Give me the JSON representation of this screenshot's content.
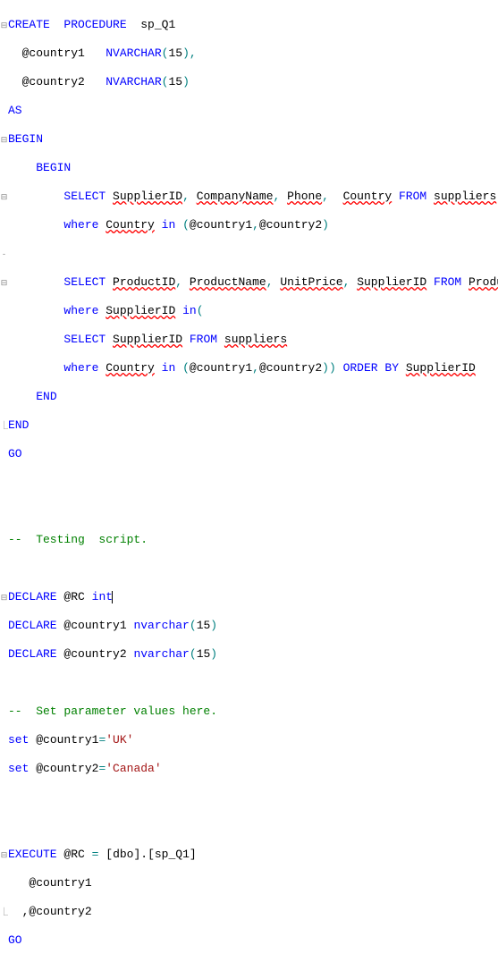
{
  "code": {
    "l1_kw1": "CREATE",
    "l1_kw2": "PROCEDURE",
    "l1_id": "sp_Q1",
    "l2_id": "@country1",
    "l2_type": "NVARCHAR",
    "l2_num": "15",
    "l3_id": "@country2",
    "l3_type": "NVARCHAR",
    "l3_num": "15",
    "l4": "AS",
    "l5": "BEGIN",
    "l6": "BEGIN",
    "l7_kw": "SELECT",
    "l7_c1": "SupplierID",
    "l7_c2": "CompanyName",
    "l7_c3": "Phone",
    "l7_c4": "Country",
    "l7_from": "FROM",
    "l7_tbl": "suppliers",
    "l8_where": "where",
    "l8_col": "Country",
    "l8_in": "in",
    "l8_p1": "@country1",
    "l8_p2": "@country2",
    "l10_kw": "SELECT",
    "l10_c1": "ProductID",
    "l10_c2": "ProductName",
    "l10_c3": "UnitPrice",
    "l10_c4": "SupplierID",
    "l10_from": "FROM",
    "l10_tbl": "Products",
    "l11_where": "where",
    "l11_col": "SupplierID",
    "l11_in": "in",
    "l12_kw": "SELECT",
    "l12_col": "SupplierID",
    "l12_from": "FROM",
    "l12_tbl": "suppliers",
    "l13_where": "where",
    "l13_col": "Country",
    "l13_in": "in",
    "l13_p1": "@country1",
    "l13_p2": "@country2",
    "l13_ord": "ORDER",
    "l13_by": "BY",
    "l13_oc": "SupplierID",
    "l14": "END",
    "l15": "END",
    "l16": "GO",
    "l19": "--  Testing  script.",
    "l21_kw": "DECLARE",
    "l21_id": "@RC",
    "l21_type": "int",
    "l22_kw": "DECLARE",
    "l22_id": "@country1",
    "l22_type": "nvarchar",
    "l22_num": "15",
    "l23_kw": "DECLARE",
    "l23_id": "@country2",
    "l23_type": "nvarchar",
    "l23_num": "15",
    "l25": "--  Set parameter values here.",
    "l26_kw": "set",
    "l26_id": "@country1",
    "l26_val": "'UK'",
    "l27_kw": "set",
    "l27_id": "@country2",
    "l27_val": "'Canada'",
    "l30_kw": "EXECUTE",
    "l30_id": "@RC",
    "l30_eq": "=",
    "l30_obj": "[dbo].[sp_Q1]",
    "l31_id": "@country1",
    "l32_id": ",@country2",
    "l33": "GO"
  }
}
